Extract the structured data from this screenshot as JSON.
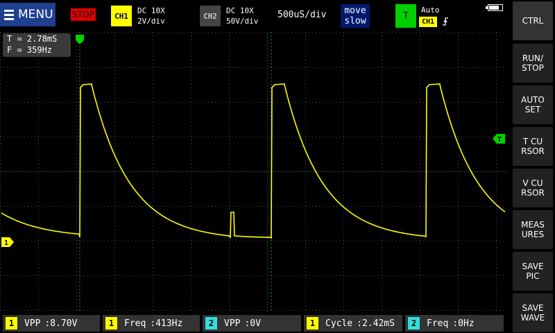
{
  "header": {
    "menu_label": "MENU",
    "run_state": "STOP",
    "ch1": {
      "tag": "CH1",
      "coupling": "DC 10X",
      "scale": "2V/div"
    },
    "ch2": {
      "tag": "CH2",
      "coupling": "DC 10X",
      "scale": "50V/div"
    },
    "timebase": "500uS/div",
    "move_label_1": "move",
    "move_label_2": "slow",
    "trigger": {
      "tag": "T",
      "mode": "Auto",
      "source": "CH1",
      "edge_icon": "rising-edge-icon"
    }
  },
  "readout": {
    "period": "T = 2.78mS",
    "frequency": "F = 359Hz"
  },
  "sidebar": {
    "buttons": [
      {
        "label": "CTRL"
      },
      {
        "label": "RUN/\nSTOP"
      },
      {
        "label": "AUTO\nSET"
      },
      {
        "label": "T CU\nRSOR"
      },
      {
        "label": "V CU\nRSOR"
      },
      {
        "label": "MEAS\nURES"
      },
      {
        "label": "SAVE\nPIC"
      },
      {
        "label": "SAVE\nWAVE"
      }
    ]
  },
  "markers": {
    "ch1_marker": "1",
    "trigger_marker": "T"
  },
  "measurements": [
    {
      "channel": "1",
      "label": "VPP",
      "value": ":8.70V"
    },
    {
      "channel": "1",
      "label": "Freq",
      "value": ":413Hz"
    },
    {
      "channel": "2",
      "label": "VPP",
      "value": ":0V"
    },
    {
      "channel": "1",
      "label": "Cycle",
      "value": ":2.42mS"
    },
    {
      "channel": "2",
      "label": "Freq",
      "value": ":0Hz"
    }
  ],
  "colors": {
    "ch1": "#ffff00",
    "ch2": "#33dddd",
    "cursor": "#00c000",
    "grid": "#505050"
  }
}
